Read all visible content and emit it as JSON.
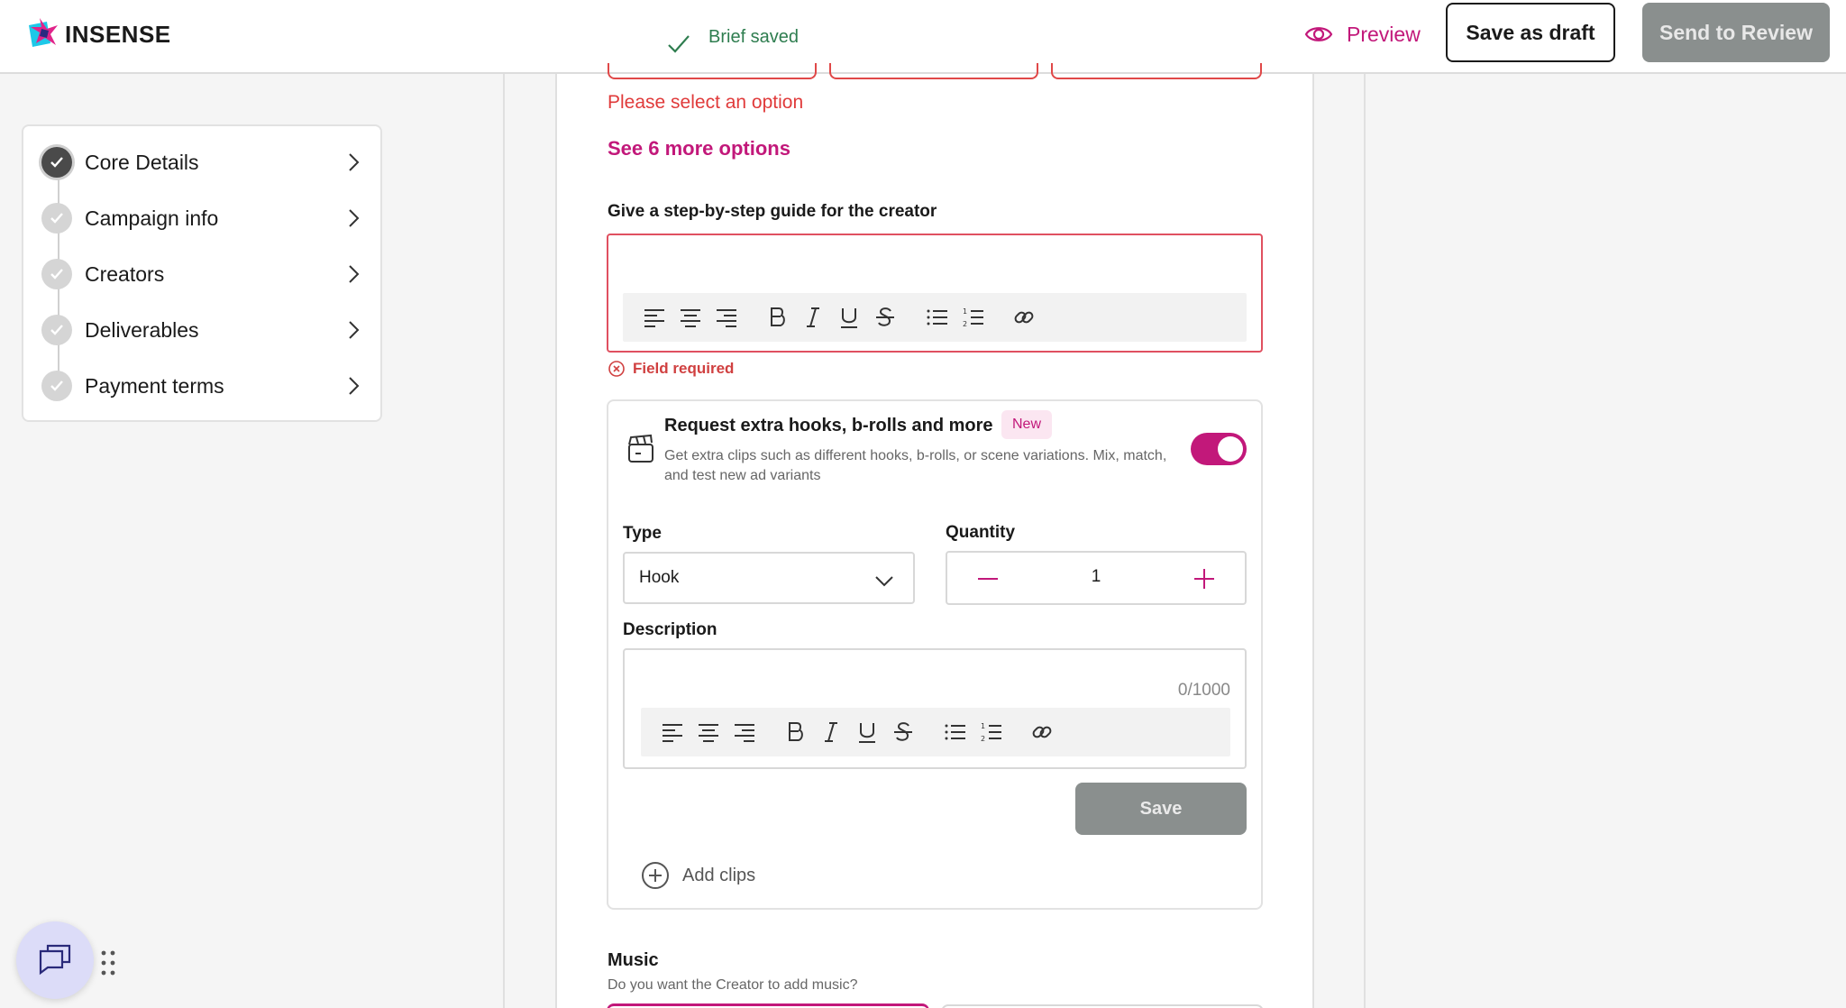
{
  "header": {
    "logo_text": "INSENSE",
    "saved_status": "Brief saved",
    "preview_label": "Preview",
    "save_draft_label": "Save as draft",
    "send_review_label": "Send to Review"
  },
  "sidebar": {
    "items": [
      {
        "label": "Core Details",
        "state": "active"
      },
      {
        "label": "Campaign info",
        "state": "pending"
      },
      {
        "label": "Creators",
        "state": "pending"
      },
      {
        "label": "Deliverables",
        "state": "pending"
      },
      {
        "label": "Payment terms",
        "state": "pending"
      }
    ]
  },
  "main": {
    "select_error": "Please select an option",
    "see_more": "See 6 more options",
    "guide_label": "Give a step-by-step guide for the creator",
    "field_required": "Field required",
    "hooks": {
      "title": "Request extra hooks, b-rolls and more",
      "badge": "New",
      "description": "Get extra clips such as different hooks, b-rolls, or scene variations. Mix, match, and test new ad variants",
      "toggle_on": true,
      "type_label": "Type",
      "type_value": "Hook",
      "quantity_label": "Quantity",
      "quantity_value": "1",
      "description_label": "Description",
      "char_count": "0/1000",
      "save_label": "Save",
      "add_clips_label": "Add clips"
    },
    "music": {
      "title": "Music",
      "subtitle": "Do you want the Creator to add music?"
    }
  },
  "colors": {
    "accent": "#c2187a",
    "error": "#e03a3a",
    "success": "#2e7d4f",
    "disabled_button": "#8a8f8e"
  },
  "icons": [
    "check-icon",
    "eye-icon",
    "chevron-right-icon",
    "align-left-icon",
    "align-center-icon",
    "align-right-icon",
    "bold-icon",
    "italic-icon",
    "underline-icon",
    "strikethrough-icon",
    "bullet-list-icon",
    "numbered-list-icon",
    "link-icon",
    "error-circle-icon",
    "clapperboard-icon",
    "chevron-down-icon",
    "minus-icon",
    "plus-icon",
    "add-circle-icon",
    "chat-icon",
    "drag-handle-icon"
  ]
}
